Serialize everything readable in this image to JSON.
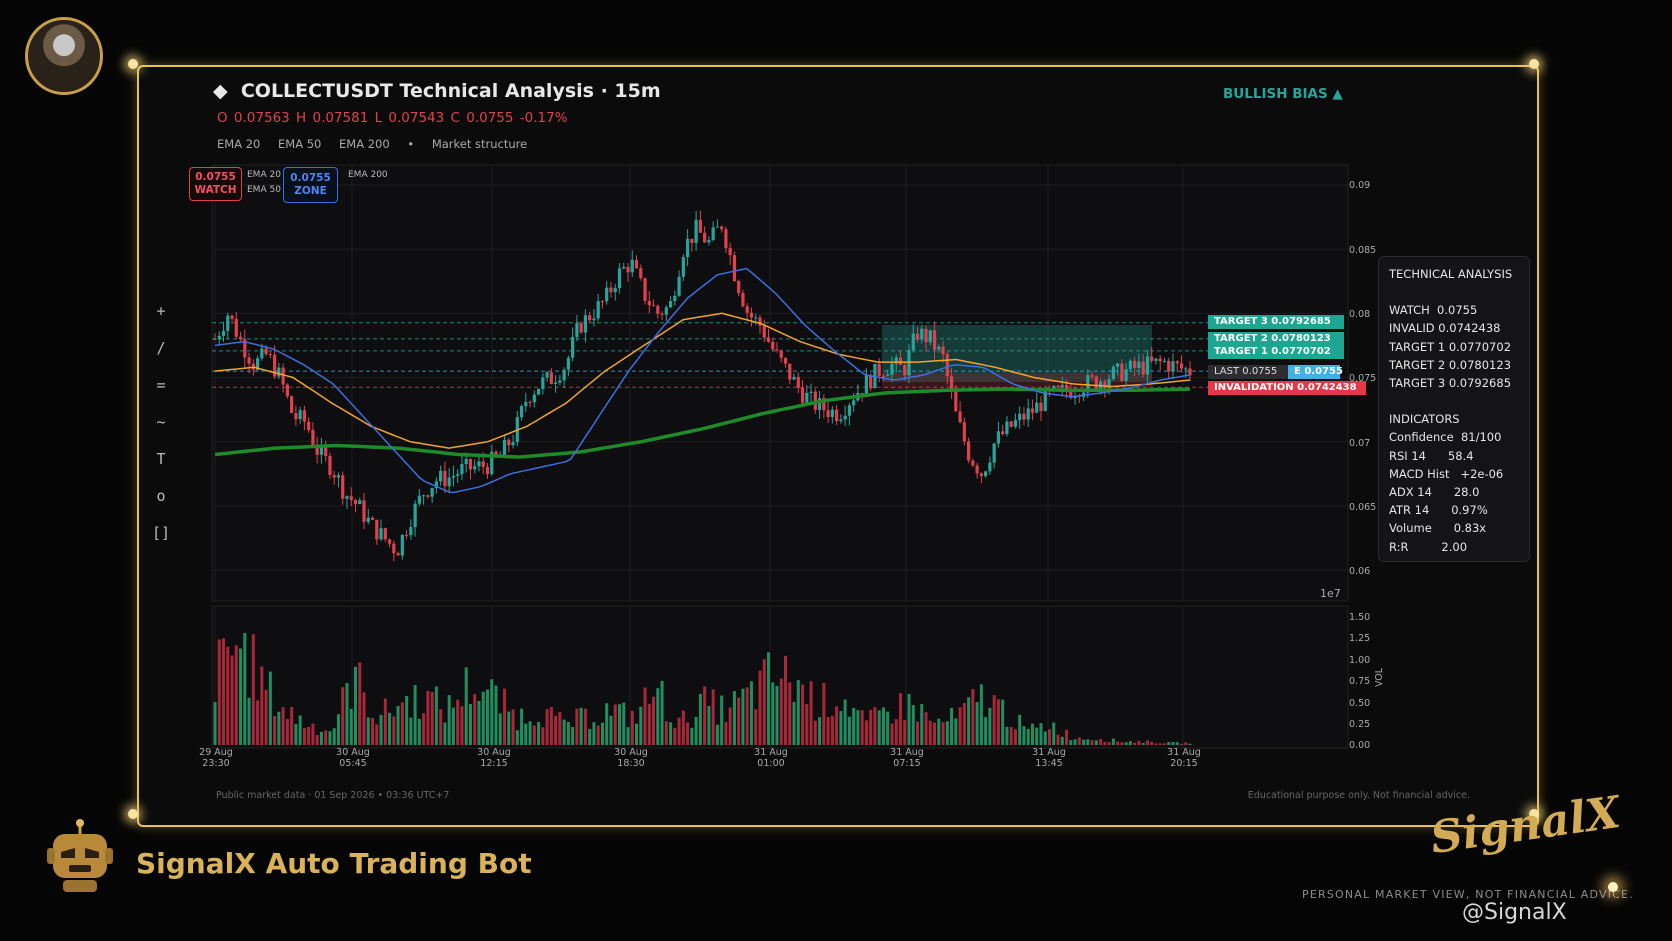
{
  "header": {
    "diamond": "◆",
    "title": "COLLECTUSDT Technical Analysis  ·  15m",
    "ohlc": "O 0.07563   H 0.07581   L 0.07543   C 0.0755   -0.17%",
    "legend": [
      "EMA 20",
      "EMA 50",
      "EMA 200",
      "•",
      "Market structure"
    ],
    "bias": "BULLISH BIAS  ▲"
  },
  "toolbar": [
    "+",
    "/",
    "=",
    "~",
    "T",
    "o",
    "[]"
  ],
  "badges": {
    "watch_value": "0.0755",
    "watch_label": "WATCH",
    "zone_value": "0.0755",
    "zone_label": "ZONE",
    "mini_legend": [
      "EMA 20",
      "EMA 50",
      "EMA 200"
    ]
  },
  "level_tags": {
    "target3": "TARGET 3  0.0792685",
    "target2": "TARGET 2  0.0780123",
    "target1": "TARGET 1  0.0770702",
    "last": "LAST  0.0755",
    "zone": "E  0.0755",
    "invalidation": "INVALIDATION  0.0742438"
  },
  "price_axis": [
    "0.09",
    "0.085",
    "0.08",
    "0.075",
    "0.07",
    "0.065",
    "0.06"
  ],
  "volume_axis_labels": [
    "1.50",
    "1.25",
    "1.00",
    "0.75",
    "0.50",
    "0.25",
    "0.00"
  ],
  "volume_axis_title": "VOL",
  "scale_note": "1e7",
  "x_axis": [
    {
      "date": "29 Aug",
      "time": "23:30"
    },
    {
      "date": "30 Aug",
      "time": "05:45"
    },
    {
      "date": "30 Aug",
      "time": "12:15"
    },
    {
      "date": "30 Aug",
      "time": "18:30"
    },
    {
      "date": "31 Aug",
      "time": "01:00"
    },
    {
      "date": "31 Aug",
      "time": "07:15"
    },
    {
      "date": "31 Aug",
      "time": "13:45"
    },
    {
      "date": "31 Aug",
      "time": "20:15"
    }
  ],
  "analysis_panel": {
    "heading": "TECHNICAL ANALYSIS",
    "levels": [
      "WATCH  0.0755",
      "INVALID 0.0742438",
      "TARGET 1 0.0770702",
      "TARGET 2 0.0780123",
      "TARGET 3 0.0792685"
    ],
    "ind_heading": "INDICATORS",
    "indicators": [
      "Confidence  81/100",
      "RSI 14      58.4",
      "MACD Hist   +2e-06",
      "ADX 14      28.0",
      "ATR 14      0.97%",
      "Volume      0.83x",
      "R:R         2.00"
    ]
  },
  "footer": {
    "left": "Public market data   ·   01 Sep 2026 • 03:36 UTC+7",
    "right": "Educational purpose only. Not financial advice."
  },
  "branding": {
    "bot_name": "SignalX Auto Trading Bot",
    "logo_text": "SignalX",
    "disclaimer": "PERSONAL MARKET VIEW, NOT FINANCIAL ADVICE.",
    "watermark": "@SignalX"
  },
  "colors": {
    "up": "#26a69a",
    "down": "#e0414e",
    "ema20": "#3d6fe0",
    "ema50": "#f0a42b",
    "ema200": "#1e8a2a",
    "gold": "#e7bf57"
  },
  "chart_data": {
    "type": "candlestick",
    "symbol": "COLLECTUSDT",
    "interval": "15m",
    "ylim": [
      0.06,
      0.09
    ],
    "levels": {
      "target3": 0.0792685,
      "target2": 0.0780123,
      "target1": 0.0770702,
      "watch": 0.0755,
      "invalidation": 0.0742438
    },
    "close_path": [
      0.078,
      0.08,
      0.0778,
      0.076,
      0.0768,
      0.075,
      0.072,
      0.0715,
      0.069,
      0.068,
      0.066,
      0.065,
      0.0635,
      0.0625,
      0.0615,
      0.064,
      0.066,
      0.067,
      0.0672,
      0.0678,
      0.068,
      0.0682,
      0.069,
      0.0705,
      0.0735,
      0.0745,
      0.075,
      0.076,
      0.079,
      0.08,
      0.081,
      0.083,
      0.084,
      0.0815,
      0.08,
      0.0805,
      0.085,
      0.0865,
      0.0855,
      0.087,
      0.083,
      0.08,
      0.079,
      0.077,
      0.0755,
      0.074,
      0.073,
      0.0725,
      0.0722,
      0.0735,
      0.0745,
      0.0755,
      0.076,
      0.0756,
      0.0785,
      0.078,
      0.0765,
      0.072,
      0.069,
      0.0675,
      0.07,
      0.071,
      0.0718,
      0.0725,
      0.0735,
      0.0738,
      0.0741,
      0.0745,
      0.0748,
      0.0752,
      0.0755,
      0.0758,
      0.076,
      0.0762,
      0.0758,
      0.0755
    ],
    "ema20_path": [
      0.0775,
      0.0778,
      0.0772,
      0.076,
      0.0745,
      0.072,
      0.0695,
      0.067,
      0.066,
      0.0665,
      0.0675,
      0.068,
      0.0685,
      0.072,
      0.0755,
      0.0785,
      0.0812,
      0.083,
      0.0835,
      0.0815,
      0.079,
      0.077,
      0.0752,
      0.0748,
      0.0752,
      0.076,
      0.0758,
      0.0745,
      0.0738,
      0.0735,
      0.0738,
      0.0742,
      0.0748,
      0.0752
    ],
    "ema50_path": [
      0.0755,
      0.0758,
      0.075,
      0.073,
      0.0712,
      0.07,
      0.0695,
      0.07,
      0.0712,
      0.073,
      0.0755,
      0.0775,
      0.0795,
      0.08,
      0.0792,
      0.0778,
      0.0768,
      0.0762,
      0.0762,
      0.0764,
      0.0758,
      0.075,
      0.0745,
      0.0743,
      0.0745,
      0.0748
    ],
    "ema200_path": [
      0.069,
      0.0695,
      0.0697,
      0.0695,
      0.069,
      0.0688,
      0.0692,
      0.07,
      0.071,
      0.0722,
      0.0732,
      0.0738,
      0.074,
      0.0741,
      0.074,
      0.074,
      0.0741
    ],
    "volume_path": [
      1.0,
      1.5,
      0.9,
      0.5,
      0.3,
      0.2,
      1.0,
      0.4,
      0.6,
      0.7,
      0.5,
      0.9,
      0.7,
      0.4,
      0.5,
      0.3,
      0.4,
      0.5,
      0.4,
      0.8,
      0.3,
      0.6,
      0.5,
      0.7,
      1.0,
      0.9,
      0.6,
      0.7,
      0.3,
      0.5,
      0.6,
      0.3,
      0.4,
      0.7,
      0.5,
      0.2,
      0.3,
      0.1,
      0.1,
      0.05,
      0.05,
      0.03,
      0.03
    ]
  }
}
